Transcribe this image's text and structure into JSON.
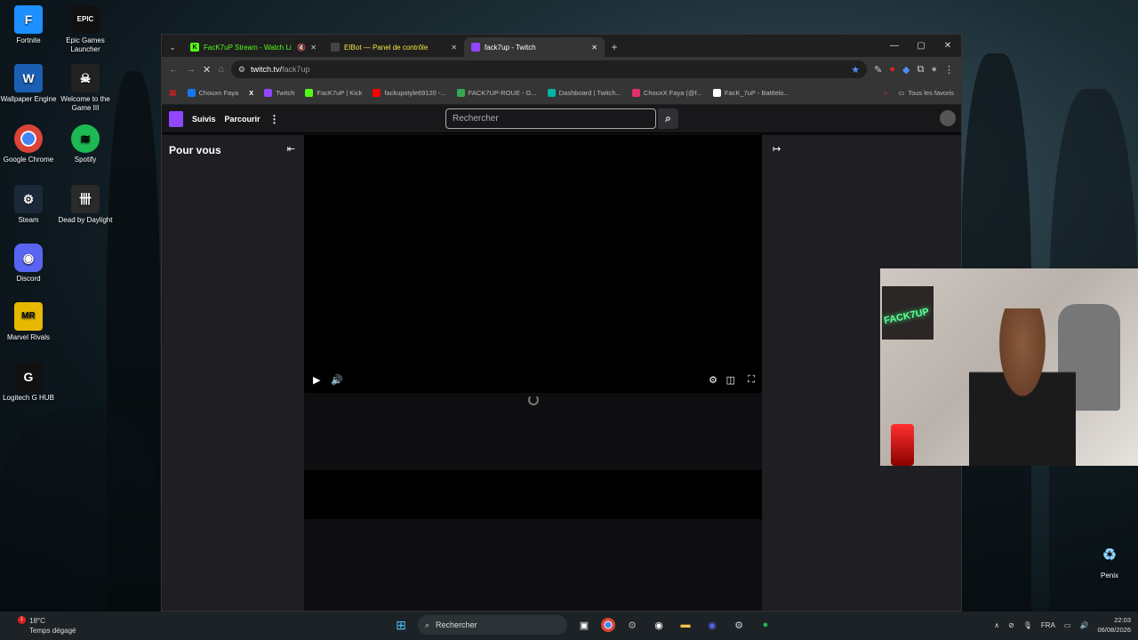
{
  "desktop": {
    "icons": [
      {
        "label": "Fortnite",
        "icon": "fortnite-icon",
        "color": "#1e90ff",
        "glyph": "F"
      },
      {
        "label": "Epic Games Launcher",
        "icon": "epic-games-icon",
        "color": "#111111",
        "glyph": "EPIC"
      },
      {
        "label": "Wallpaper Engine",
        "icon": "wallpaper-engine-icon",
        "color": "#1a5fb4",
        "glyph": "W"
      },
      {
        "label": "Welcome to the Game III",
        "icon": "welcome-game-icon",
        "color": "#222222",
        "glyph": "☠"
      },
      {
        "label": "Google Chrome",
        "icon": "chrome-icon",
        "color": "#db4437",
        "glyph": "●"
      },
      {
        "label": "Spotify",
        "icon": "spotify-icon",
        "color": "#1db954",
        "glyph": "≋"
      },
      {
        "label": "Steam",
        "icon": "steam-icon",
        "color": "#1b2838",
        "glyph": "⚙"
      },
      {
        "label": "Dead by Daylight",
        "icon": "dead-by-daylight-icon",
        "color": "#2a2a2a",
        "glyph": "卌"
      },
      {
        "label": "Discord",
        "icon": "discord-icon",
        "color": "#5865f2",
        "glyph": "◉"
      },
      {
        "label": "Marvel Rivals",
        "icon": "marvel-rivals-icon",
        "color": "#e6b800",
        "glyph": "MR"
      },
      {
        "label": "Logitech G HUB",
        "icon": "logitech-icon",
        "color": "#111111",
        "glyph": "G"
      }
    ],
    "recycle_bin_label": "Penix"
  },
  "browser": {
    "tabs": [
      {
        "label": "FacK7uP Stream - Watch Li",
        "fav": "K",
        "fav_color": "#53fc18"
      },
      {
        "label": "EIBot — Panel de contrôle",
        "fav": "E",
        "fav_color": "#444444"
      },
      {
        "label": "fack7up - Twitch",
        "fav": "♦",
        "fav_color": "#9146ff"
      }
    ],
    "new_tab": "+",
    "url_host": "twitch.tv/",
    "url_path": "fack7up",
    "bookmarks": [
      {
        "label": "Chouxn Faya",
        "color": "#1877f2"
      },
      {
        "label": "X",
        "color": "#000000"
      },
      {
        "label": "Twitch",
        "color": "#9146ff"
      },
      {
        "label": "FacK7uP | Kick",
        "color": "#53fc18"
      },
      {
        "label": "fackupstyle69120 -...",
        "color": "#ff0000"
      },
      {
        "label": "FACK7UP-ROUE - G...",
        "color": "#34a853"
      },
      {
        "label": "Dashboard | Twitch...",
        "color": "#00b3a4"
      },
      {
        "label": "ChouxX Faya (@f...",
        "color": "#e1306c"
      },
      {
        "label": "FacK_7uP - Battlelo...",
        "color": "#ffffff"
      }
    ],
    "bookmarks_more": "»",
    "all_favorites": "Tous les favoris"
  },
  "twitch": {
    "nav_following": "Suivis",
    "nav_browse": "Parcourir",
    "search_placeholder": "Rechercher",
    "left_title": "Pour vous"
  },
  "taskbar": {
    "weather_temp": "18°C",
    "weather_desc": "Temps dégagé",
    "weather_badge": "1",
    "search_label": "Rechercher",
    "language": "FRA",
    "time": "22:03",
    "date": "06/08/2026"
  }
}
